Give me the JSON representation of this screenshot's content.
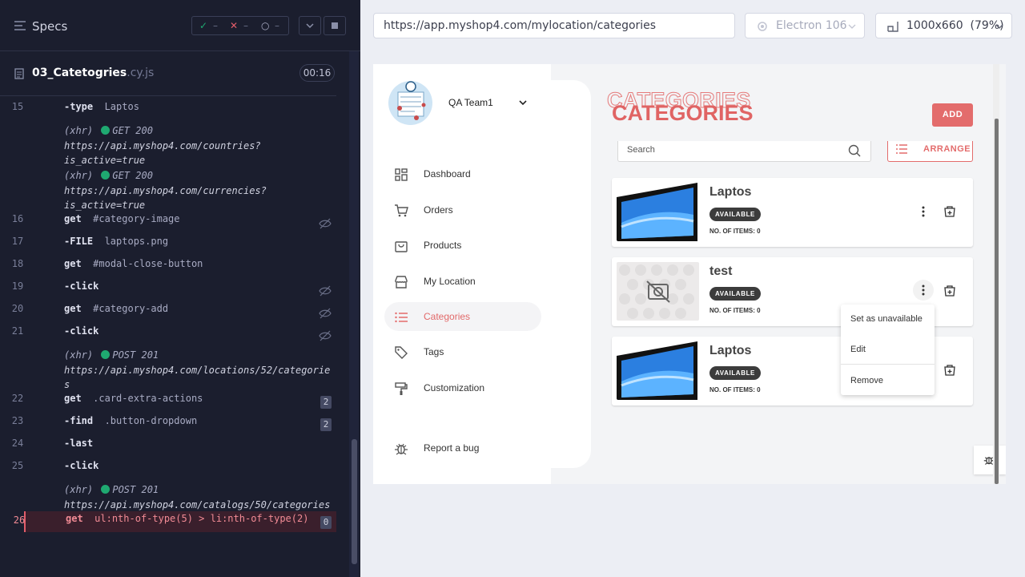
{
  "runner": {
    "title": "Specs",
    "stats": {
      "passed": "✓",
      "passed_count": "–",
      "failed": "✕",
      "failed_count": "–",
      "pending": "○",
      "pending_count": "–"
    },
    "file": {
      "name": "03_Catetogries",
      "ext": ".cy.js",
      "duration": "00:16"
    },
    "log": [
      {
        "n": "15",
        "cmd": "-type",
        "arg": "Laptos"
      },
      {
        "xhr": "(xhr)",
        "method": "GET 200",
        "url1": "https://api.myshop4.com/countries?",
        "url2": "is_active=true"
      },
      {
        "xhr": "(xhr)",
        "method": "GET 200",
        "url1": "https://api.myshop4.com/currencies?",
        "url2": "is_active=true"
      },
      {
        "n": "16",
        "cmd": "get",
        "arg": "#category-image"
      },
      {
        "n": "17",
        "cmd": "-FILE",
        "arg": "laptops.png"
      },
      {
        "n": "18",
        "cmd": "get",
        "arg": "#modal-close-button"
      },
      {
        "n": "19",
        "cmd": "-click",
        "arg": ""
      },
      {
        "n": "20",
        "cmd": "get",
        "arg": "#category-add"
      },
      {
        "n": "21",
        "cmd": "-click",
        "arg": ""
      },
      {
        "xhr": "(xhr)",
        "method": "POST 201",
        "url1": "https://api.myshop4.com/locations/52/categorie",
        "url2": "s"
      },
      {
        "n": "22",
        "cmd": "get",
        "arg": ".card-extra-actions",
        "badge": "2"
      },
      {
        "n": "23",
        "cmd": "-find",
        "arg": ".button-dropdown",
        "badge": "2"
      },
      {
        "n": "24",
        "cmd": "-last",
        "arg": ""
      },
      {
        "n": "25",
        "cmd": "-click",
        "arg": ""
      },
      {
        "xhr": "(xhr)",
        "method": "POST 201",
        "url1": "https://api.myshop4.com/catalogs/50/categories"
      },
      {
        "n": "26",
        "cmd": "get",
        "arg": "ul:nth-of-type(5) > li:nth-of-type(2)",
        "badge": "0"
      }
    ]
  },
  "browser": {
    "url": "https://app.myshop4.com/mylocation/categories",
    "engine": "Electron 106",
    "viewport": "1000x660",
    "zoom": "(79%)"
  },
  "app": {
    "team": "QA Team1",
    "nav": [
      "Dashboard",
      "Orders",
      "Products",
      "My Location",
      "Categories",
      "Tags",
      "Customization",
      "Report a bug"
    ],
    "page_title": "CATEGORIES",
    "add_label": "ADD",
    "search_placeholder": "Search",
    "arrange_label": "ARRANGE",
    "cards": [
      {
        "name": "Laptos",
        "status": "AVAILABLE",
        "count": "NO. OF ITEMS: 0"
      },
      {
        "name": "test",
        "status": "AVAILABLE",
        "count": "NO. OF ITEMS: 0"
      },
      {
        "name": "Laptos",
        "status": "AVAILABLE",
        "count": "NO. OF ITEMS: 0"
      }
    ],
    "dropdown": [
      "Set as unavailable",
      "Edit",
      "Remove"
    ]
  },
  "colors": {
    "accent": "#e36c6c",
    "runner_bg": "#1b1e2e",
    "pass": "#1fa971",
    "fail": "#e35d6a"
  }
}
